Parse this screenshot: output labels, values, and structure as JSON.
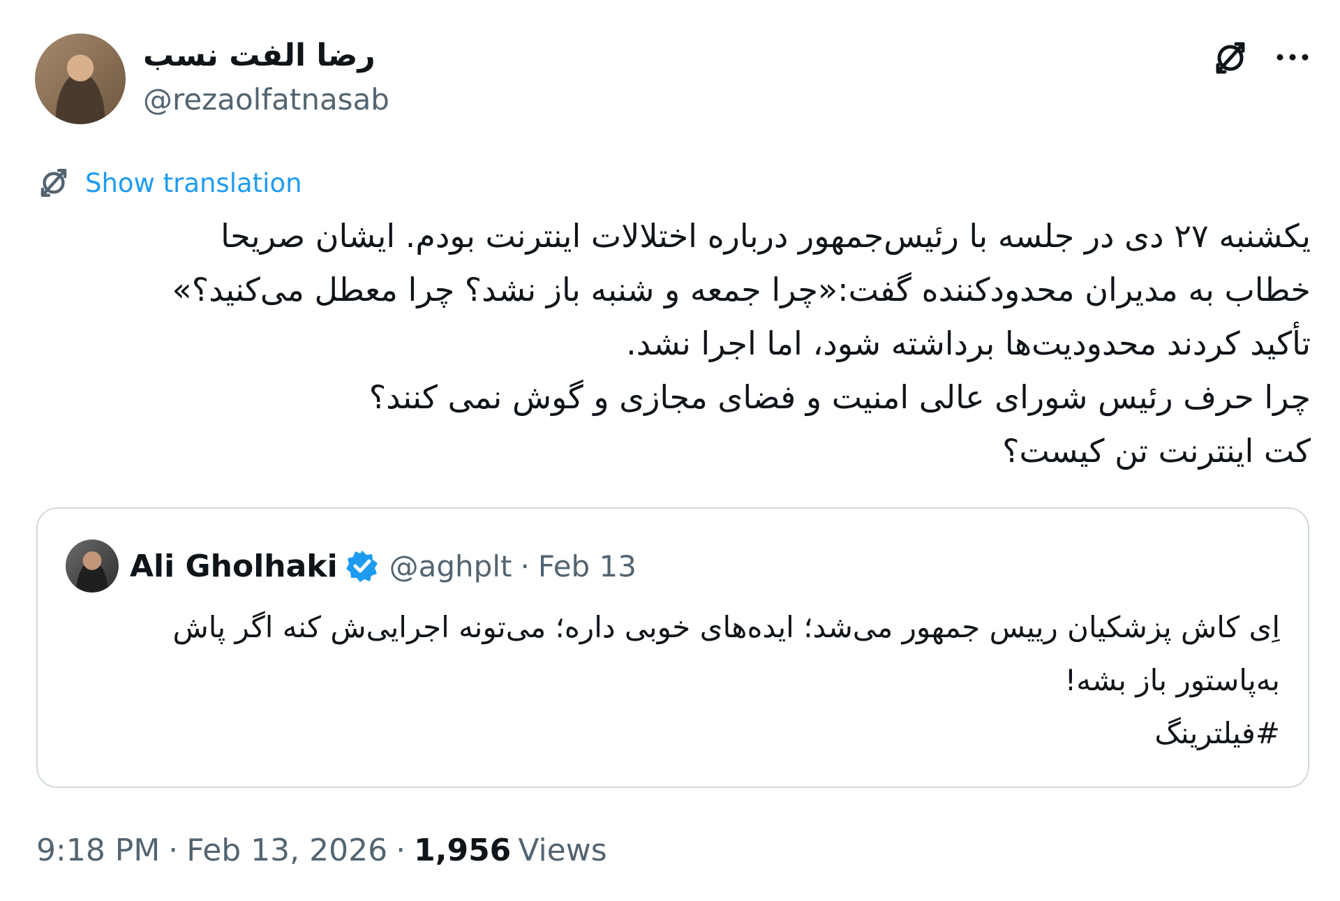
{
  "author": {
    "display_name": "رضا الفت نسب",
    "handle": "@rezaolfatnasab",
    "avatar_icon": "avatar"
  },
  "header_actions": {
    "translate_icon": "translate-icon",
    "more_icon": "more-icon"
  },
  "translation": {
    "label": "Show translation"
  },
  "tweet": {
    "lines": [
      "یکشنبه ۲۷ دی در جلسه با رئیس‌جمهور درباره اختلالات اینترنت بودم. ایشان صریحا",
      "خطاب به مدیران محدودکننده گفت:«چرا جمعه و شنبه باز نشد؟ چرا معطل می‌کنید؟»",
      "تأکید کردند محدودیت‌ها برداشته شود، اما اجرا نشد.",
      "چرا حرف رئیس شورای عالی امنیت و فضای مجازی و گوش نمی کنند؟",
      "کت اینترنت تن کیست؟"
    ]
  },
  "quoted_tweet": {
    "name": "Ali Gholhaki",
    "handle": "@aghplt",
    "separator": "·",
    "date": "Feb 13",
    "verified": true,
    "lines": [
      "اِی کاش پزشکیان رییس جمهور می‌شد؛ ایده‌های خوبی داره؛ می‌تونه اجرایی‌ش کنه اگر پاش",
      "به‌پاستور باز بشه!",
      "#فیلترینگ"
    ]
  },
  "meta": {
    "time": "9:18 PM",
    "separator": "·",
    "date": "Feb 13, 2026",
    "views_count": "1,956",
    "views_label": "Views"
  },
  "colors": {
    "text": "#0f1419",
    "secondary": "#536471",
    "link": "#1d9bf0",
    "border": "#cfd9de",
    "verified": "#1d9bf0"
  }
}
